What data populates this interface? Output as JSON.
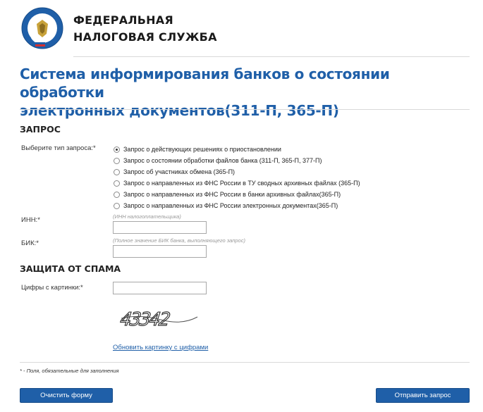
{
  "header": {
    "org_line1": "ФЕДЕРАЛЬНАЯ",
    "org_line2": "НАЛОГОВАЯ СЛУЖБА",
    "logo_icon": "fns-emblem-icon"
  },
  "page": {
    "title_line1": "Система информирования банков о состоянии обработки",
    "title_line2": "электронных документов(311-П, 365-П)"
  },
  "request": {
    "section_title": "ЗАПРОС",
    "type_label": "Выберите тип запроса:*",
    "options": [
      "Запрос о действующих решениях о приостановлении",
      "Запрос о состоянии обработки файлов банка (311-П, 365-П, 377-П)",
      "Запрос об участниках обмена (365-П)",
      "Запрос о направленных из ФНС России в ТУ сводных архивных файлах (365-П)",
      "Запрос о направленных из ФНС России в банки архивных файлах(365-П)",
      "Запрос о направленных из ФНС России электронных документах(365-П)"
    ],
    "selected_index": 0,
    "inn_label": "ИНН:*",
    "inn_hint": "(ИНН налогоплательщика)",
    "inn_value": "",
    "bik_label": "БИК:*",
    "bik_hint": "(Полное значение БИК банка, выполняющего запрос)",
    "bik_value": ""
  },
  "spam": {
    "section_title": "ЗАЩИТА ОТ СПАМА",
    "captcha_label": "Цифры с картинки:*",
    "captcha_value": "",
    "captcha_text": "43342",
    "refresh_link": "Обновить картинку с цифрами"
  },
  "footer": {
    "required_note": "* - Поля, обязательные для заполнения",
    "clear_button": "Очистить форму",
    "submit_button": "Отправить запрос"
  },
  "colors": {
    "accent": "#1f5fa8"
  }
}
